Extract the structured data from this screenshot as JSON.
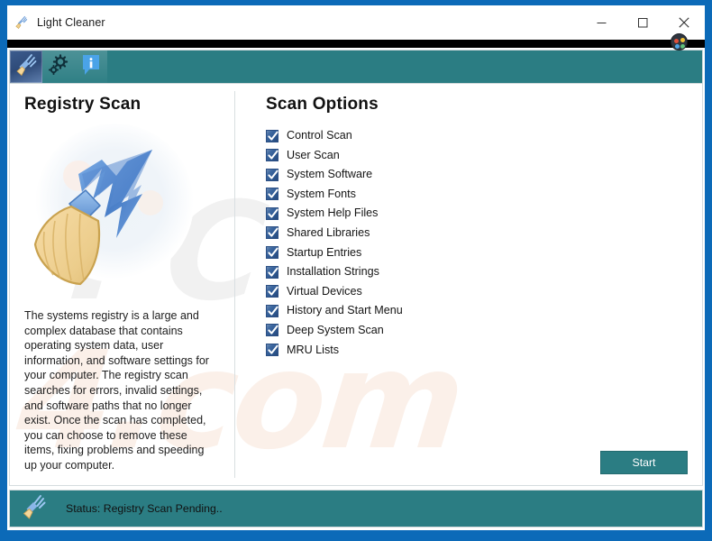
{
  "window": {
    "title": "Light Cleaner",
    "app_icon": "broom-lightning-icon",
    "minimize_label": "–",
    "maximize_label": "□",
    "close_label": "✕"
  },
  "toolbar": {
    "items": [
      {
        "name": "scan-tool",
        "icon": "broom-lightning-icon",
        "active": true
      },
      {
        "name": "settings-tool",
        "icon": "gears-icon",
        "active": false
      },
      {
        "name": "info-tool",
        "icon": "info-icon",
        "active": false
      }
    ]
  },
  "left_panel": {
    "title": "Registry Scan",
    "illustration": "broom-lightning-illustration",
    "description": "The systems registry is a large and complex database that contains operating system data, user information, and software settings for your computer. The registry scan searches for errors, invalid settings, and software paths that no longer exist. Once the scan has completed, you can choose to remove these items, fixing problems and speeding up your computer."
  },
  "right_panel": {
    "title": "Scan Options",
    "options": [
      {
        "label": "Control Scan",
        "checked": true
      },
      {
        "label": "User Scan",
        "checked": true
      },
      {
        "label": "System Software",
        "checked": true
      },
      {
        "label": "System Fonts",
        "checked": true
      },
      {
        "label": "System Help Files",
        "checked": true
      },
      {
        "label": "Shared Libraries",
        "checked": true
      },
      {
        "label": "Startup Entries",
        "checked": true
      },
      {
        "label": "Installation Strings",
        "checked": true
      },
      {
        "label": "Virtual Devices",
        "checked": true
      },
      {
        "label": "History and Start Menu",
        "checked": true
      },
      {
        "label": "Deep System Scan",
        "checked": true
      },
      {
        "label": "MRU Lists",
        "checked": true
      }
    ],
    "start_button_label": "Start"
  },
  "statusbar": {
    "icon": "broom-lightning-icon",
    "text": "Status: Registry Scan Pending.."
  },
  "watermark": {
    "top_text": "PC",
    "bottom_text": "4.com"
  },
  "colors": {
    "desktop_blue": "#0c6ab8",
    "teal": "#2b7d83",
    "checkbox_blue": "#2f5a93",
    "black_strip": "#000000"
  }
}
